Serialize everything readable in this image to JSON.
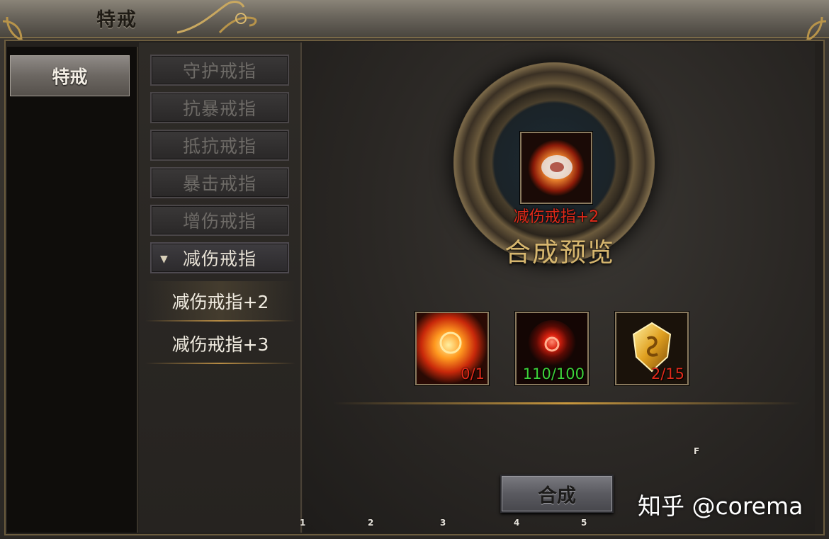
{
  "window": {
    "title": "特戒"
  },
  "sidebar": {
    "tab_label": "特戒"
  },
  "categories": [
    {
      "label": "守护戒指"
    },
    {
      "label": "抗暴戒指"
    },
    {
      "label": "抵抗戒指"
    },
    {
      "label": "暴击戒指"
    },
    {
      "label": "增伤戒指"
    },
    {
      "label": "减伤戒指",
      "expanded": true
    }
  ],
  "sub_items": [
    {
      "label": "减伤戒指+2",
      "selected": true
    },
    {
      "label": "减伤戒指+3"
    }
  ],
  "preview": {
    "item_name": "减伤戒指+2",
    "title": "合成预览",
    "icon": "ring-icon"
  },
  "materials": [
    {
      "icon": "flame-ring-icon",
      "count": "0/1",
      "count_color": "#e02a1a"
    },
    {
      "icon": "red-orb-icon",
      "count": "110/100",
      "count_color": "#3ed23a"
    },
    {
      "icon": "gold-gem-icon",
      "count": "2/15",
      "count_color": "#e02a1a"
    }
  ],
  "actions": {
    "combine_label": "合成"
  },
  "overlay": {
    "marker_f": "F",
    "markers": [
      "1",
      "2",
      "3",
      "4",
      "5"
    ],
    "watermark": "知乎 @corema"
  },
  "colors": {
    "accent_gold": "#c9983e",
    "insufficient_red": "#e02a1a",
    "sufficient_green": "#3ed23a"
  }
}
